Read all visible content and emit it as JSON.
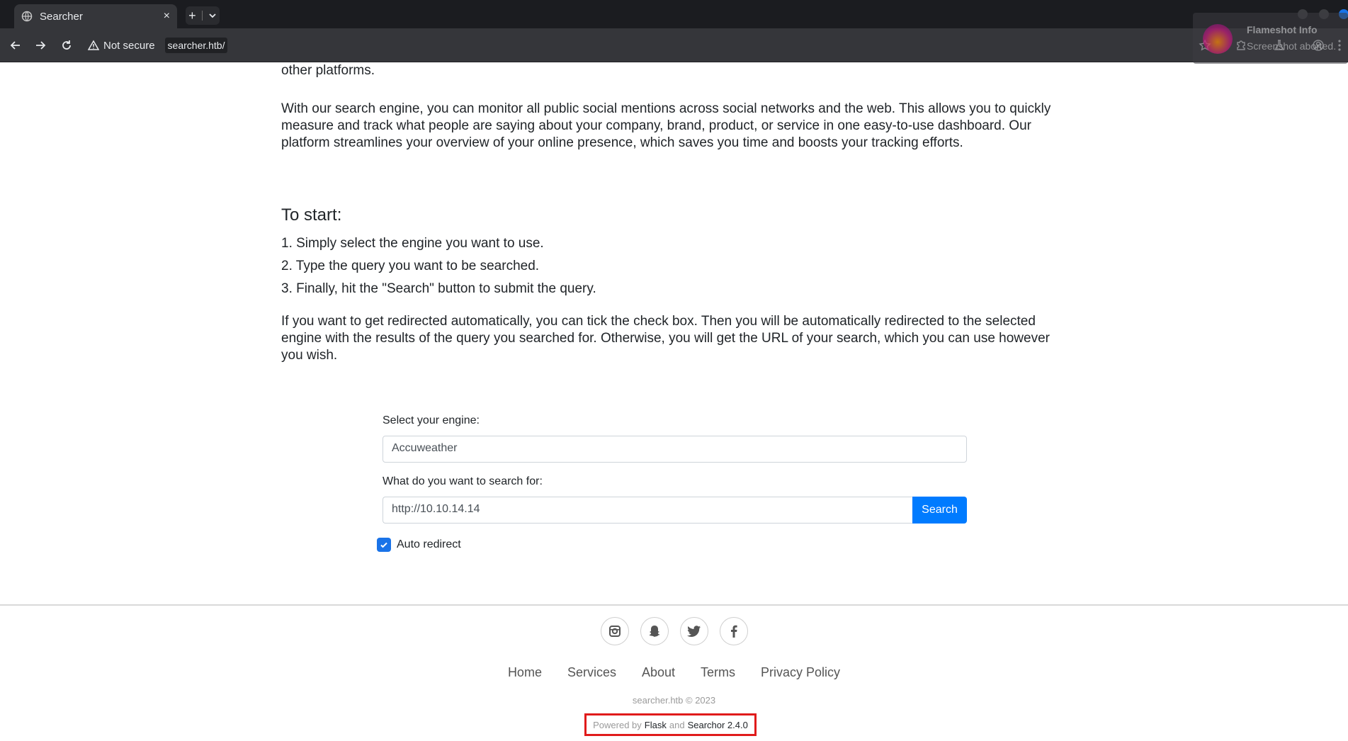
{
  "browser": {
    "tab_title": "Searcher",
    "tab_close": "×",
    "newtab_plus": "+",
    "security_label": "Not secure",
    "url": "searcher.htb/"
  },
  "flameshot": {
    "title": "Flameshot Info",
    "subtitle": "Screenshot aborted."
  },
  "page": {
    "intro_tail": "other platforms.",
    "monitor_paragraph": "With our search engine, you can monitor all public social mentions across social networks and the web. This allows you to quickly measure and track what people are saying about your company, brand, product, or service in one easy-to-use dashboard. Our platform streamlines your overview of your online presence, which saves you time and boosts your tracking efforts.",
    "start_heading": "To start:",
    "steps": [
      "1. Simply select the engine you want to use.",
      "2. Type the query you want to be searched.",
      "3. Finally, hit the \"Search\" button to submit the query."
    ],
    "redirect_paragraph": "If you want to get redirected automatically, you can tick the check box. Then you will be automatically redirected to the selected engine with the results of the query you searched for. Otherwise, you will get the URL of your search, which you can use however you wish."
  },
  "form": {
    "engine_label": "Select your engine:",
    "engine_value": "Accuweather",
    "query_label": "What do you want to search for:",
    "query_value": "http://10.10.14.14",
    "search_button": "Search",
    "auto_redirect_label": "Auto redirect",
    "auto_redirect_checked": true
  },
  "footer": {
    "links": [
      "Home",
      "Services",
      "About",
      "Terms",
      "Privacy Policy"
    ],
    "copyright": "searcher.htb © 2023",
    "powered_prefix": "Powered by",
    "powered_flask": "Flask",
    "powered_and": "and",
    "powered_searchor": "Searchor 2.4.0"
  },
  "colors": {
    "primary_button": "#007bff",
    "checkbox": "#1a73e8",
    "highlight_box": "#e01b1b"
  }
}
